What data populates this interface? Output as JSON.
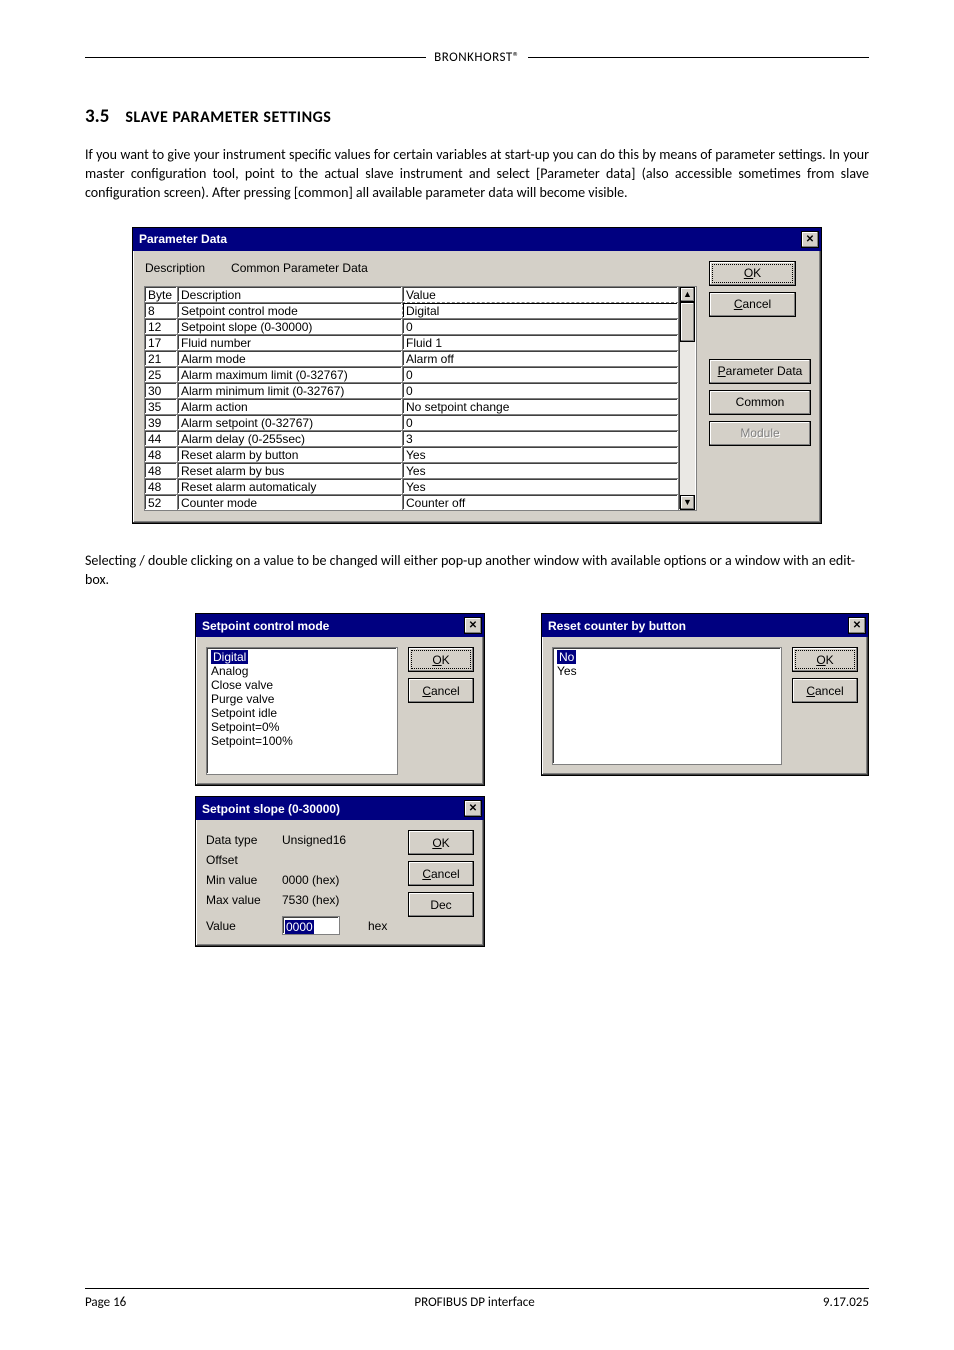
{
  "header": {
    "brand": "BRONKHORST®"
  },
  "section": {
    "number": "3.5",
    "title": "SLAVE PARAMETER SETTINGS"
  },
  "paragraph1": "If you want to give your instrument specific values for certain variables at start-up you can do this by means of parameter settings. In your master configuration tool, point to the actual slave instrument and select [Parameter data] (also accessible sometimes from slave configuration screen). After pressing [common] all available parameter data will become visible.",
  "paragraph2": "Selecting / double clicking on a value to be changed will either pop-up another window with available options or a window with an edit-box.",
  "paramDialog": {
    "title": "Parameter Data",
    "descLabel": "Description",
    "descValue": "Common Parameter Data",
    "headers": {
      "byte": "Byte",
      "desc": "Description",
      "value": "Value"
    },
    "rows": [
      {
        "byte": "8",
        "desc": "Setpoint control mode",
        "value": "Digital"
      },
      {
        "byte": "12",
        "desc": "Setpoint slope     (0-30000)",
        "value": "0"
      },
      {
        "byte": "17",
        "desc": "Fluid number",
        "value": "Fluid 1"
      },
      {
        "byte": "21",
        "desc": "Alarm mode",
        "value": "Alarm off"
      },
      {
        "byte": "25",
        "desc": "Alarm maximum limit (0-32767)",
        "value": "0"
      },
      {
        "byte": "30",
        "desc": "Alarm minimum limit (0-32767)",
        "value": "0"
      },
      {
        "byte": "35",
        "desc": "Alarm action",
        "value": "No setpoint change"
      },
      {
        "byte": "39",
        "desc": "Alarm setpoint     (0-32767)",
        "value": "0"
      },
      {
        "byte": "44",
        "desc": "Alarm delay     (0-255sec)",
        "value": "3"
      },
      {
        "byte": "48",
        "desc": "Reset alarm by button",
        "value": "Yes"
      },
      {
        "byte": "48",
        "desc": "Reset alarm by bus",
        "value": "Yes"
      },
      {
        "byte": "48",
        "desc": "Reset alarm automaticaly",
        "value": "Yes"
      },
      {
        "byte": "52",
        "desc": "Counter mode",
        "value": "Counter off"
      }
    ],
    "buttons": {
      "ok": "OK",
      "cancel": "Cancel",
      "paramData": "Parameter Data",
      "common": "Common",
      "module": "Module"
    }
  },
  "setpointDlg": {
    "title": "Setpoint control mode",
    "options": [
      "Digital",
      "Analog",
      "Close valve",
      "Purge valve",
      "Setpoint idle",
      "Setpoint=0%",
      "Setpoint=100%"
    ],
    "ok": "OK",
    "cancel": "Cancel"
  },
  "resetDlg": {
    "title": "Reset counter by button",
    "options": [
      "No",
      "Yes"
    ],
    "ok": "OK",
    "cancel": "Cancel"
  },
  "slopeDlg": {
    "title": "Setpoint slope     (0-30000)",
    "labels": {
      "dtype": "Data type",
      "offset": "Offset",
      "min": "Min value",
      "max": "Max value",
      "value": "Value",
      "hex": "hex"
    },
    "values": {
      "dtype": "Unsigned16",
      "offset": "",
      "min": "0000 (hex)",
      "max": "7530 (hex)",
      "value": "0000"
    },
    "ok": "OK",
    "cancel": "Cancel",
    "dec": "Dec"
  },
  "footer": {
    "page": "Page 16",
    "center": "PROFIBUS DP interface",
    "doc": "9.17.025"
  }
}
